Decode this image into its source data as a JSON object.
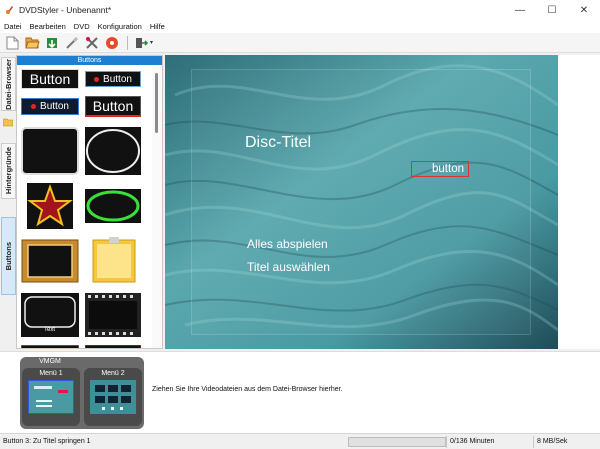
{
  "window": {
    "title": "DVDStyler - Unbenannt*",
    "minimize": "—",
    "maximize": "☐",
    "close": "✕"
  },
  "menubar": [
    "Datei",
    "Bearbeiten",
    "DVD",
    "Konfiguration",
    "Hilfe"
  ],
  "toolbar": {
    "buttons": [
      "new-icon",
      "open-icon",
      "save-icon",
      "settings-icon",
      "tools-icon",
      "burn-icon",
      "export-icon"
    ],
    "dropdown": "▾"
  },
  "sidebar": {
    "tabs": [
      "Datei-Browser",
      "Hintergründe",
      "Buttons"
    ],
    "active_tab": "Buttons",
    "panel_header": "Buttons",
    "tiles": {
      "btn_a": "Button",
      "btn_b": "Button",
      "btn_c": "Button",
      "btn_d": "Button",
      "text_frame": "Text"
    }
  },
  "preview": {
    "disc_title": "Disc-Titel",
    "button": "button",
    "play_all": "Alles abspielen",
    "select_title": "Titel auswählen"
  },
  "bottom": {
    "vmgm": "VMGM",
    "menu1": "Menü 1",
    "menu2": "Menü 2",
    "hint": "Ziehen Sie Ihre Videodateien aus dem Datei-Browser hierher."
  },
  "status": {
    "message": "Button 3: Zu Titel springen 1",
    "progress": 0,
    "minutes": "0/136 Minuten",
    "speed": "8 MB/Sek"
  },
  "colors": {
    "accent": "#1e7fd0",
    "preview_bg": "#4a9aa3",
    "highlight_border": "#dd3333"
  }
}
